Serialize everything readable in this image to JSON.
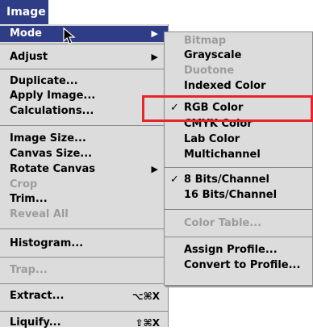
{
  "menubar": {
    "title": "Image"
  },
  "main_menu": {
    "mode": "Mode",
    "adjust": "Adjust",
    "duplicate": "Duplicate...",
    "apply_image": "Apply Image...",
    "calculations": "Calculations...",
    "image_size": "Image Size...",
    "canvas_size": "Canvas Size...",
    "rotate_canvas": "Rotate Canvas",
    "crop": "Crop",
    "trim": "Trim...",
    "reveal_all": "Reveal All",
    "histogram": "Histogram...",
    "trap": "Trap...",
    "extract": "Extract...",
    "extract_shortcut": "⌥⌘X",
    "liquify": "Liquify...",
    "liquify_shortcut": "⇧⌘X"
  },
  "mode_submenu": {
    "bitmap": "Bitmap",
    "grayscale": "Grayscale",
    "duotone": "Duotone",
    "indexed_color": "Indexed Color",
    "rgb_color": "RGB Color",
    "cmyk_color": "CMYK Color",
    "lab_color": "Lab Color",
    "multichannel": "Multichannel",
    "bits8": "8 Bits/Channel",
    "bits16": "16 Bits/Channel",
    "color_table": "Color Table...",
    "assign_profile": "Assign Profile...",
    "convert_profile": "Convert to Profile..."
  },
  "glyphs": {
    "check": "✓",
    "arrow": "▶"
  },
  "colors": {
    "highlight": "#2f3c86",
    "callout": "#e5242b",
    "menu_bg": "#dcdcdc",
    "disabled": "#9c9c9c"
  }
}
